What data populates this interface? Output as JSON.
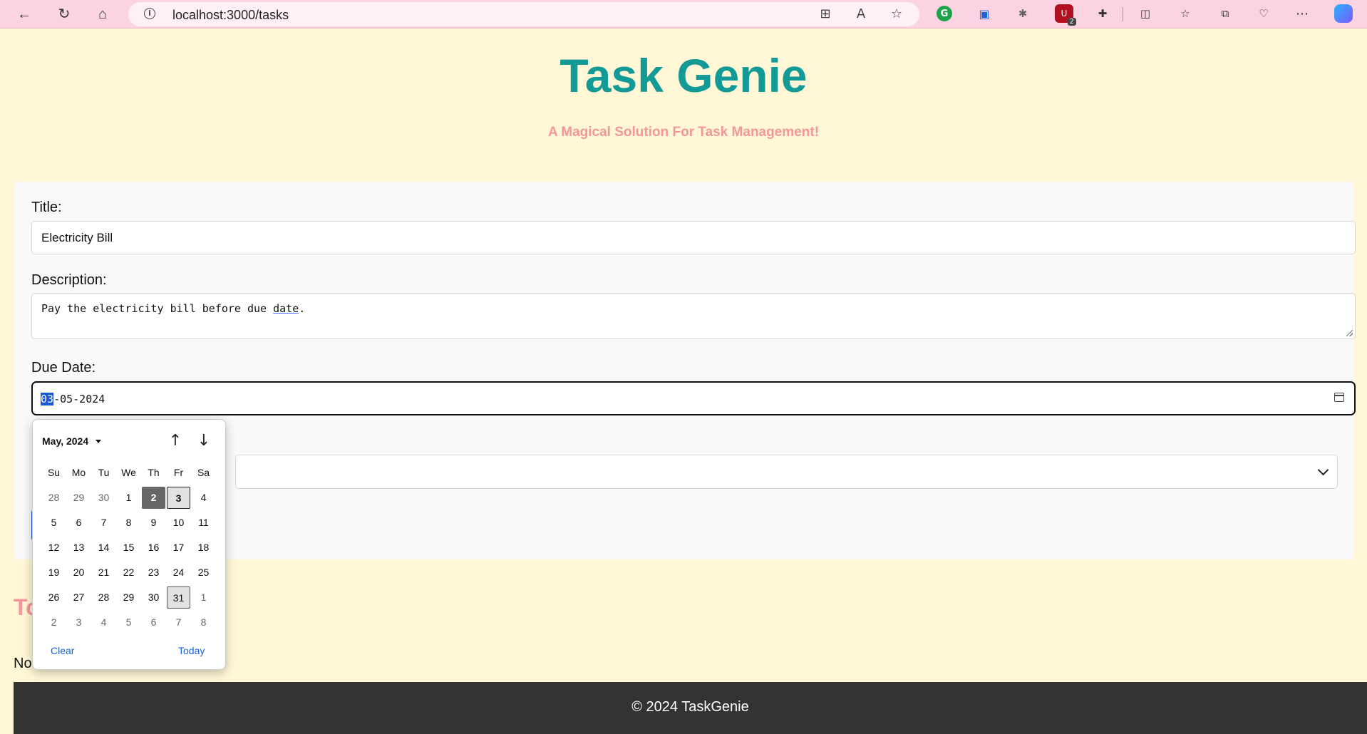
{
  "browser": {
    "back_icon": "←",
    "reload_icon": "↻",
    "home_icon": "⌂",
    "url": "localhost:3000/tasks",
    "extension_badge": "2"
  },
  "app": {
    "title": "Task Genie",
    "subtitle": "A Magical Solution For Task Management!"
  },
  "form": {
    "title_label": "Title:",
    "title_value": "Electricity Bill",
    "description_label": "Description:",
    "description_value_start": "Pay the electricity bill before due ",
    "description_value_underlined": "date",
    "description_value_end": ".",
    "due_date_label": "Due Date:",
    "due_date_day": "03",
    "due_date_rest": "-05-2024"
  },
  "datepicker": {
    "month_label": "May, 2024",
    "weekdays": [
      "Su",
      "Mo",
      "Tu",
      "We",
      "Th",
      "Fr",
      "Sa"
    ],
    "weeks": [
      [
        "28",
        "29",
        "30",
        "1",
        "2",
        "3",
        "4"
      ],
      [
        "5",
        "6",
        "7",
        "8",
        "9",
        "10",
        "11"
      ],
      [
        "12",
        "13",
        "14",
        "15",
        "16",
        "17",
        "18"
      ],
      [
        "19",
        "20",
        "21",
        "22",
        "23",
        "24",
        "25"
      ],
      [
        "26",
        "27",
        "28",
        "29",
        "30",
        "31",
        "1"
      ],
      [
        "2",
        "3",
        "4",
        "5",
        "6",
        "7",
        "8"
      ]
    ],
    "selected_day": "3",
    "today_day": "2",
    "clear_label": "Clear",
    "today_label": "Today"
  },
  "tasks_section": {
    "heading_visible": "To",
    "empty_visible": "No"
  },
  "footer": {
    "text": "© 2024 TaskGenie"
  },
  "colors": {
    "page_bg": "#fff7d6",
    "title": "#129a96",
    "subtitle": "#f4979b",
    "chrome_bg": "#fbd3e2",
    "accent": "#1a62d6"
  }
}
